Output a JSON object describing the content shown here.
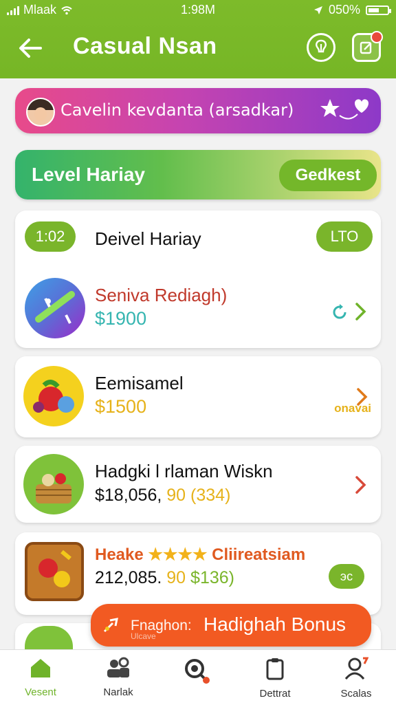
{
  "status": {
    "carrier": "Mlaak",
    "time": "1:98M",
    "battery": "050%"
  },
  "header": {
    "title": "Casual Nsan"
  },
  "profile": {
    "text": "Cavelin kevdanta (arsadkar)"
  },
  "level": {
    "label": "Level Hariay",
    "button": "Gedkest"
  },
  "card1": {
    "badge": "1:02",
    "title": "Deivel Hariay",
    "pill": "LTO",
    "item": {
      "title": "Seniva Rediagh)",
      "price": "$1900",
      "color_title": "#c0392b",
      "color_price": "#35b5b0"
    }
  },
  "card2": {
    "title": "Eemisamel",
    "price": "$1500",
    "tag": "onavai",
    "price_color": "#e6b21a"
  },
  "card3": {
    "title": "Hadgki l rlaman Wiskn",
    "price_a": "$18,056,",
    "price_b": "90",
    "price_c": "(334)"
  },
  "card4": {
    "title_a": "Heake",
    "stars": "★★★★",
    "title_b": "Cliireatsiam",
    "price_a": "212,085.",
    "price_b": "90",
    "price_c": "$136)",
    "pill": "эс"
  },
  "bonus": {
    "text_small": "Fnaghon:",
    "text_small_sub": "Ulcave",
    "text": "Hadighah Bonus"
  },
  "nav": [
    {
      "label": "Vesent",
      "icon": "home-icon",
      "active": true
    },
    {
      "label": "Narlak",
      "icon": "people-icon",
      "active": false
    },
    {
      "label": "",
      "icon": "search-icon",
      "active": false
    },
    {
      "label": "Dettrat",
      "icon": "clipboard-icon",
      "active": false
    },
    {
      "label": "Scalas",
      "icon": "profile-icon",
      "active": false
    }
  ],
  "colors": {
    "accent": "#77b729",
    "orange": "#f25a22",
    "magenta": "#c644b0"
  }
}
